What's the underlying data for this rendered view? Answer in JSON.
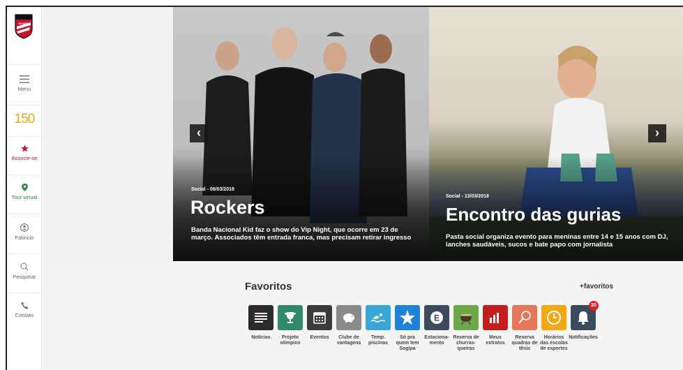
{
  "sidebar": {
    "logo_text": "SOGIPA",
    "menu_label": "Menu",
    "anniversary": "150",
    "associe_label": "Associe-se",
    "tour_label": "Tour virtual",
    "user_label": "Fabricio",
    "search_label": "Pesquisar",
    "contact_label": "Contato"
  },
  "carousel": {
    "dot_count": 5,
    "slides": [
      {
        "category": "Social - 06/03/2018",
        "title": "Rockers",
        "description": "Banda Nacional Kid faz o show do Vip Night, que ocorre em 23 de março. Associados têm entrada franca, mas precisam retirar ingresso"
      },
      {
        "category": "Social - 13/03/2018",
        "title": "Encontro das gurias",
        "description": "Pasta social organiza evento para meninas entre 14 e 15 anos com DJ, lanches saudáveis, sucos e bate papo com jornalista"
      }
    ],
    "prev_label": "‹",
    "next_label": "›"
  },
  "favorites": {
    "title": "Favoritos",
    "add_label": "+favoritos",
    "items": [
      {
        "label": "Notícias",
        "color": "#2b2b2b",
        "icon": "news-icon"
      },
      {
        "label": "Projeto olímpico",
        "color": "#2f8a6a",
        "icon": "trophy-icon"
      },
      {
        "label": "Eventos",
        "color": "#3a3a3a",
        "icon": "calendar-icon"
      },
      {
        "label": "Clube de vantagens",
        "color": "#8a8a8a",
        "icon": "piggy-bank-icon"
      },
      {
        "label": "Temp. piscinas",
        "color": "#3aa7d8",
        "icon": "swimmer-icon"
      },
      {
        "label": "Só pra quem tem Sogipa",
        "color": "#1f82d6",
        "icon": "star-icon"
      },
      {
        "label": "Estaciona-mento",
        "color": "#3a4a5c",
        "icon": "parking-icon"
      },
      {
        "label": "Reserva de churras-queiras",
        "color": "#6ea84a",
        "icon": "grill-icon"
      },
      {
        "label": "Meus extratos",
        "color": "#c41f1f",
        "icon": "bar-chart-icon"
      },
      {
        "label": "Reserva quadras de tênis",
        "color": "#e5785a",
        "icon": "tennis-racket-icon"
      },
      {
        "label": "Horários das escolas de esportes",
        "color": "#f2a713",
        "icon": "clock-icon"
      },
      {
        "label": "Notificações",
        "color": "#3a4a5c",
        "icon": "bell-icon",
        "badge": "25"
      }
    ]
  },
  "colors": {
    "brand_red": "#c8102e",
    "tour_green": "#2f8a3e"
  }
}
